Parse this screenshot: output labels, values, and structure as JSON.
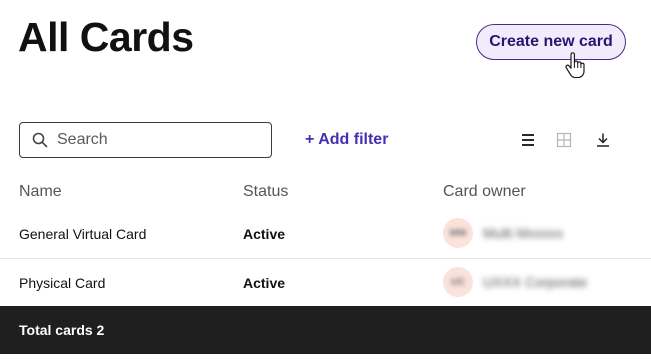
{
  "header": {
    "title": "All Cards",
    "create_button_label": "Create new card"
  },
  "toolbar": {
    "search_placeholder": "Search",
    "add_filter_label": "+ Add filter",
    "view_icons": [
      "list-view-icon",
      "grid-view-icon",
      "download-icon"
    ]
  },
  "table": {
    "columns": [
      "Name",
      "Status",
      "Card owner"
    ],
    "rows": [
      {
        "name": "General Virtual Card",
        "status": "Active",
        "owner_initials": "MM",
        "owner_name": "Multi Mxxxxx"
      },
      {
        "name": "Physical Card",
        "status": "Active",
        "owner_initials": "UC",
        "owner_name": "UXXX Corporate"
      }
    ]
  },
  "footer": {
    "total_label": "Total cards 2"
  },
  "colors": {
    "accent": "#4530b5",
    "button_border": "#4b2a8a",
    "button_bg": "#f1ecfb",
    "footer_bg": "#1f1f1f",
    "avatar_bg": "#fbe3dc"
  }
}
